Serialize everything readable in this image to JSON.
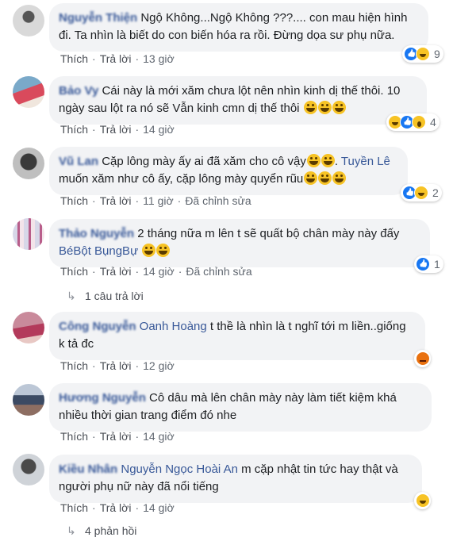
{
  "common": {
    "like_label": "Thích",
    "reply_label": "Trả lời",
    "dot": "·"
  },
  "comments": [
    {
      "author": "Nguyễn Thiện",
      "text": "Ngộ Không...Ngộ Không ???.... con mau hiện hình đi. Ta nhìn là biết do con biến hóa ra rồi. Đừng dọa sư phụ nữa.",
      "time": "13 giờ",
      "reaction_count": "9",
      "reactions": [
        "like",
        "haha"
      ]
    },
    {
      "author": "Bảo Vy",
      "text": "Cái này là mới xăm chưa lột nên nhìn kinh dị thế thôi. 10 ngày sau lột ra nó sẽ Vẫn kinh cmn dị thế thôi",
      "emoji_count": 3,
      "time": "14 giờ",
      "reaction_count": "4",
      "reactions": [
        "haha",
        "like",
        "wow"
      ]
    },
    {
      "author": "Vũ Lan",
      "text_before_tag": "Cặp lông mày ấy ai đã xăm cho cô vậy",
      "tag": "Tuyền Lê",
      "text_after_tag": "muốn xăm như cô ấy, cặp lông mày quyển rũu",
      "time": "11 giờ",
      "edited": "Đã chỉnh sửa",
      "reaction_count": "2",
      "reactions": [
        "like",
        "haha"
      ]
    },
    {
      "author": "Thảo Nguyễn",
      "text": "2 tháng nữa m lên t sẽ quất bộ chân mày này đấy",
      "tag": "BéBột BụngBự",
      "time": "14 giờ",
      "edited": "Đã chỉnh sửa",
      "reaction_count": "1",
      "reactions": [
        "like"
      ],
      "replies_label": "1 câu trả lời"
    },
    {
      "author": "Công Nguyễn",
      "tag": "Oanh Hoàng",
      "text": "t thề là nhìn là t nghĩ tới m liền..giống k tả đc",
      "time": "12 giờ",
      "reaction_count": "",
      "reactions": [
        "angry"
      ]
    },
    {
      "author": "Hương Nguyễn",
      "text": "Cô dâu mà lên chân mày này làm tiết kiệm khá nhiều thời gian trang điểm đó nhe",
      "time": "14 giờ"
    },
    {
      "author": "Kiều Nhân",
      "tag": "Nguyễn Ngọc Hoài An",
      "text": "m cặp nhật tin tức hay thật và người phụ nữ này đã nổi tiếng",
      "time": "14 giờ",
      "reaction_count": "",
      "reactions": [
        "haha"
      ],
      "replies_label": "4 phản hồi"
    }
  ],
  "colors": {
    "bubble": "#f2f3f5",
    "link": "#385898",
    "meta": "#606770",
    "like": "#1877f2",
    "haha": "#f7c325",
    "angry": "#e9710f"
  }
}
